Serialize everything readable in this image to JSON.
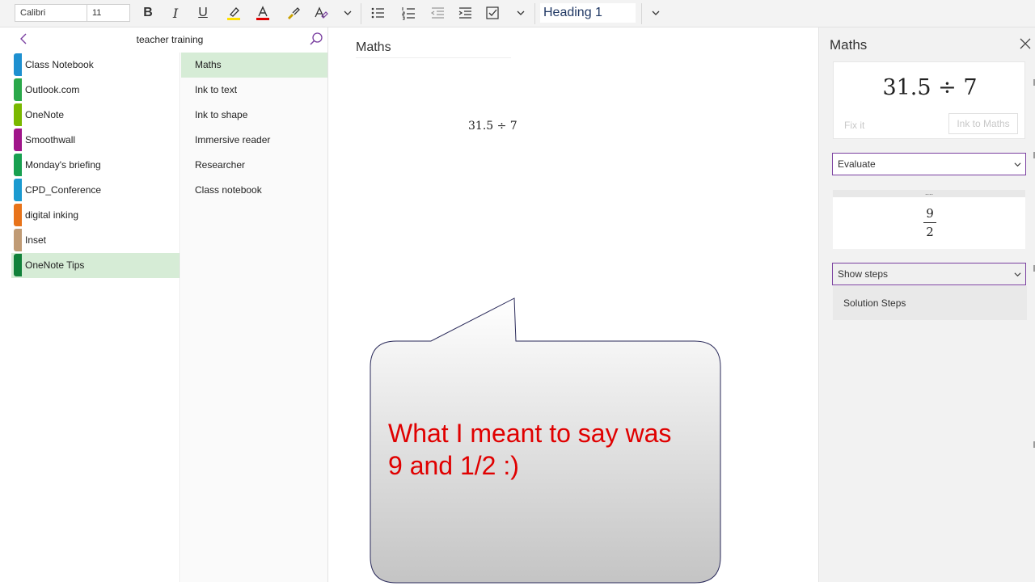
{
  "ribbon": {
    "font_name": "Calibri",
    "font_size": "11",
    "bold": "B",
    "italic": "I",
    "underline": "U",
    "style": "Heading 1"
  },
  "colors": {
    "accent_purple": "#7a3fa0",
    "selected_green": "#d6ecd6",
    "bubble_text_red": "#e00000"
  },
  "notebook": {
    "title": "teacher training",
    "sections": [
      {
        "label": "Class Notebook",
        "color": "#1e90d0"
      },
      {
        "label": "Outlook.com",
        "color": "#2aa84a"
      },
      {
        "label": "OneNote",
        "color": "#7ab800"
      },
      {
        "label": "Smoothwall",
        "color": "#a0158a"
      },
      {
        "label": "Monday's briefing",
        "color": "#18a050"
      },
      {
        "label": "CPD_Conference",
        "color": "#1b9ad0"
      },
      {
        "label": "digital inking",
        "color": "#e8731a"
      },
      {
        "label": "Inset",
        "color": "#c09b75"
      },
      {
        "label": "OneNote Tips",
        "color": "#11813a"
      }
    ],
    "pages": [
      "Maths",
      "Ink to text",
      "Ink to shape",
      "Immersive reader",
      "Researcher",
      "Class notebook"
    ]
  },
  "canvas": {
    "page_title": "Maths",
    "equation": "31.5 ÷ 7",
    "bubble_line1": "What I meant to say was",
    "bubble_line2": "9 and 1/2 :)"
  },
  "math_pane": {
    "title": "Maths",
    "equation": "31.5 ÷ 7",
    "fix_it": "Fix it",
    "ink_to_maths": "Ink to Maths",
    "action_select": "Evaluate",
    "more_dots": "....",
    "result_numerator": "9",
    "result_denominator": "2",
    "steps_select": "Show steps",
    "solution_steps": "Solution Steps"
  }
}
